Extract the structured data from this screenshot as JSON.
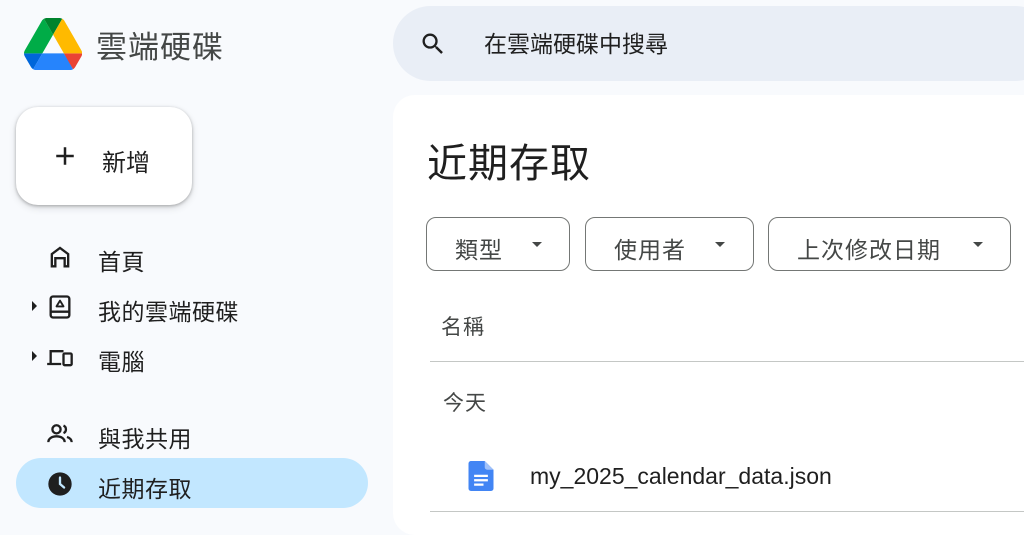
{
  "app": {
    "name": "雲端硬碟"
  },
  "search": {
    "placeholder": "在雲端硬碟中搜尋"
  },
  "new_button": {
    "label": "新增"
  },
  "sidebar": {
    "items": [
      {
        "label": "首頁",
        "icon": "home-icon",
        "active": false,
        "expandable": false
      },
      {
        "label": "我的雲端硬碟",
        "icon": "my-drive-icon",
        "active": false,
        "expandable": true
      },
      {
        "label": "電腦",
        "icon": "computers-icon",
        "active": false,
        "expandable": true
      },
      {
        "label": "與我共用",
        "icon": "shared-people-icon",
        "active": false,
        "expandable": false
      },
      {
        "label": "近期存取",
        "icon": "recent-clock-icon",
        "active": true,
        "expandable": false
      }
    ]
  },
  "main": {
    "title": "近期存取",
    "filters": [
      {
        "label": "類型"
      },
      {
        "label": "使用者"
      },
      {
        "label": "上次修改日期"
      }
    ],
    "column_header": "名稱",
    "groups": [
      {
        "label": "今天",
        "files": [
          {
            "name": "my_2025_calendar_data.json",
            "icon": "document-icon"
          }
        ]
      }
    ]
  },
  "colors": {
    "accent_active": "#c2e7ff",
    "search_bg": "#e9eef6",
    "page_bg": "#f8fafd",
    "doc_icon_blue": "#4285f4"
  }
}
